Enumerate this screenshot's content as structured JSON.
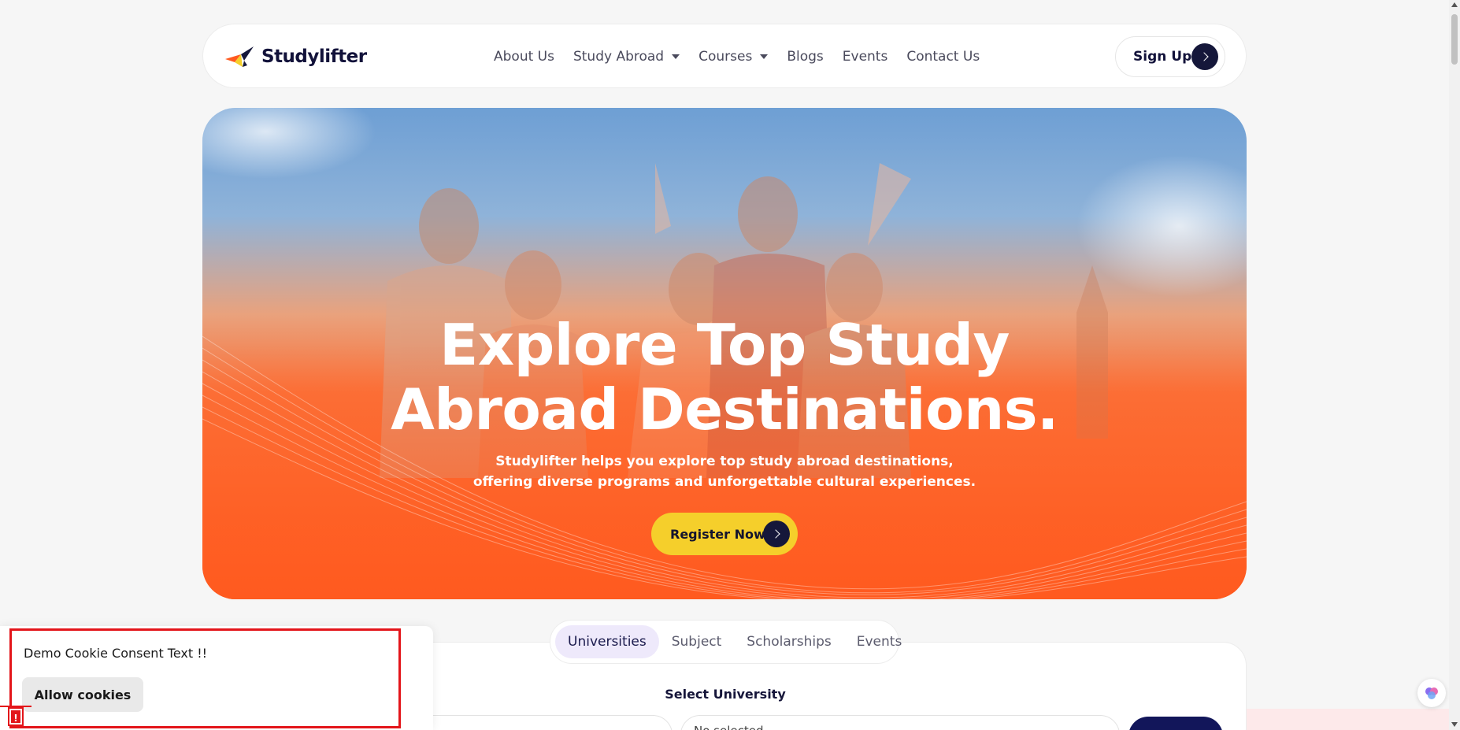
{
  "brand": {
    "name": "Studylifter",
    "accent": "#ff5a1f",
    "navy": "#15173a",
    "yellow": "#f5cf2b"
  },
  "nav": {
    "items": [
      {
        "label": "About Us",
        "dropdown": false
      },
      {
        "label": "Study Abroad",
        "dropdown": true
      },
      {
        "label": "Courses",
        "dropdown": true
      },
      {
        "label": "Blogs",
        "dropdown": false
      },
      {
        "label": "Events",
        "dropdown": false
      },
      {
        "label": "Contact Us",
        "dropdown": false
      }
    ],
    "signup_label": "Sign Up"
  },
  "hero": {
    "title_line1": "Explore Top Study",
    "title_line2": "Abroad Destinations.",
    "subtitle_line1": "Studylifter helps you explore top study abroad destinations,",
    "subtitle_line2": "offering diverse programs and unforgettable cultural experiences.",
    "cta_label": "Register Now"
  },
  "search": {
    "tabs": [
      {
        "label": "Universities",
        "active": true
      },
      {
        "label": "Subject",
        "active": false
      },
      {
        "label": "Scholarships",
        "active": false
      },
      {
        "label": "Events",
        "active": false
      }
    ],
    "select_label": "Select University",
    "select_value": "No  selected"
  },
  "cookie": {
    "text": "Demo Cookie Consent Text !!",
    "button_label": "Allow cookies",
    "badge": "!"
  }
}
